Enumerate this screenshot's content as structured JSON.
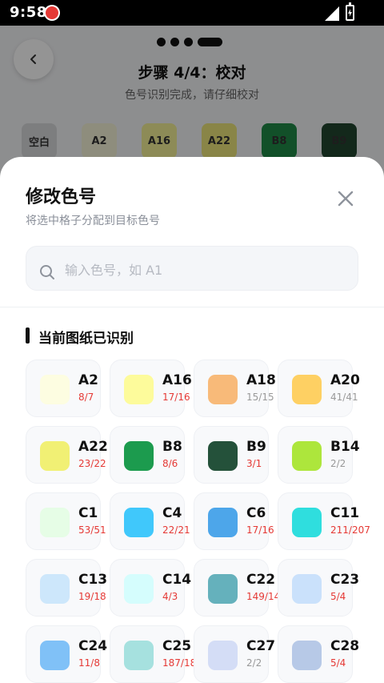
{
  "status_bar": {
    "time": "9:58"
  },
  "header": {
    "step_title": "步骤 4/4：校对",
    "step_subtitle": "色号识别完成，请仔细校对"
  },
  "chips": [
    {
      "label": "空白",
      "color": "#d8d9db"
    },
    {
      "label": "A2",
      "color": "#f4f3d7"
    },
    {
      "label": "A16",
      "color": "#f3ef96"
    },
    {
      "label": "A22",
      "color": "#ede57a"
    },
    {
      "label": "B8",
      "color": "#1f8b47"
    },
    {
      "label": "B9",
      "color": "#22452f"
    }
  ],
  "sheet": {
    "title": "修改色号",
    "subtitle": "将选中格子分配到目标色号",
    "search_placeholder": "输入色号，如 A1",
    "section_title": "当前图纸已识别"
  },
  "colors": [
    {
      "code": "A2",
      "count": "8/7",
      "swatch": "#fdfde1",
      "mismatch": true
    },
    {
      "code": "A16",
      "count": "17/16",
      "swatch": "#fdfb9b",
      "mismatch": true
    },
    {
      "code": "A18",
      "count": "15/15",
      "swatch": "#f8ba79",
      "mismatch": false
    },
    {
      "code": "A20",
      "count": "41/41",
      "swatch": "#fed063",
      "mismatch": false
    },
    {
      "code": "A22",
      "count": "23/22",
      "swatch": "#f1f074",
      "mismatch": true
    },
    {
      "code": "B8",
      "count": "8/6",
      "swatch": "#1c9b4e",
      "mismatch": true
    },
    {
      "code": "B9",
      "count": "3/1",
      "swatch": "#24513a",
      "mismatch": true
    },
    {
      "code": "B14",
      "count": "2/2",
      "swatch": "#ade63c",
      "mismatch": false
    },
    {
      "code": "C1",
      "count": "53/51",
      "swatch": "#e6fde6",
      "mismatch": true
    },
    {
      "code": "C4",
      "count": "22/21",
      "swatch": "#40c8fb",
      "mismatch": true
    },
    {
      "code": "C6",
      "count": "17/16",
      "swatch": "#4da6ea",
      "mismatch": true
    },
    {
      "code": "C11",
      "count": "211/207",
      "swatch": "#2fdede",
      "mismatch": true
    },
    {
      "code": "C13",
      "count": "19/18",
      "swatch": "#cde7fb",
      "mismatch": true
    },
    {
      "code": "C14",
      "count": "4/3",
      "swatch": "#d5fdfd",
      "mismatch": true
    },
    {
      "code": "C22",
      "count": "149/14",
      "swatch": "#65b1bc",
      "mismatch": true
    },
    {
      "code": "C23",
      "count": "5/4",
      "swatch": "#cae1fb",
      "mismatch": true
    },
    {
      "code": "C24",
      "count": "11/8",
      "swatch": "#80c1f7",
      "mismatch": true
    },
    {
      "code": "C25",
      "count": "187/18",
      "swatch": "#a6e1df",
      "mismatch": true
    },
    {
      "code": "C27",
      "count": "2/2",
      "swatch": "#d4ddf6",
      "mismatch": false
    },
    {
      "code": "C28",
      "count": "5/4",
      "swatch": "#b7c9e7",
      "mismatch": true
    }
  ]
}
